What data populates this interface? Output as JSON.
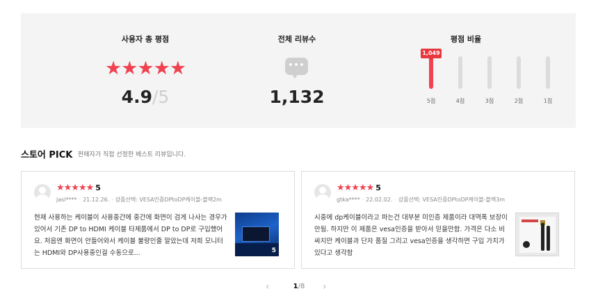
{
  "summary": {
    "total_rating_title": "사용자 총 평점",
    "stars": "★★★★★",
    "score": "4.9",
    "score_slash": "/",
    "score_max": "5",
    "review_count_title": "전체 리뷰수",
    "review_count": "1,132",
    "ratio_title": "평점 비율",
    "ratio_bars": [
      {
        "label": "5점",
        "count": "1,049",
        "fraction": 1.0
      },
      {
        "label": "4점",
        "count": "",
        "fraction": 0
      },
      {
        "label": "3점",
        "count": "",
        "fraction": 0
      },
      {
        "label": "2점",
        "count": "",
        "fraction": 0
      },
      {
        "label": "1점",
        "count": "",
        "fraction": 0
      }
    ]
  },
  "pick": {
    "title": "스토어 PICK",
    "subtitle": "판매자가 직접 선정한 베스트 리뷰입니다."
  },
  "reviews": [
    {
      "stars": "★★★★★",
      "rating": "5",
      "user": "jasl****",
      "date": "21.12.26.",
      "option": "상품선택: VESA인증DPtoDP케이블-블랙2m",
      "text": "현재 사용하는 케이블이 사용중간에 중간에 화면이 검게 나사는 경우가 있어서 기존 DP to HDMI 케이블 타제품에서 DP to DP로 구입했어요. 처음엔 화면이 안들어와서 케이블 불량인줄 알았는데 저희 모니터는 HDMI와 DP사용중인걸 수동으로...",
      "image_count": "5"
    },
    {
      "stars": "★★★★★",
      "rating": "5",
      "user": "gtka****",
      "date": "22.02.02.",
      "option": "상품선택: VESA인증DPtoDP케이블-블랙3m",
      "text": "시중에 dp케이블이라고 파는건 대부분 미인증 제품이라 대역폭 보장이 안됨. 하지만 이 제품은 vesa인증을 받아서 믿을만함. 가격은 다소 비싸지만 케이블과 단자 품질 그리고 vesa인증을 생각하면 구입 가치가 있다고 생각함",
      "image_count": ""
    }
  ],
  "pagination": {
    "current": "1",
    "separator": "/",
    "total": "8",
    "prev_icon": "chevron-left-icon",
    "next_icon": "chevron-right-icon"
  },
  "colors": {
    "accent": "#f0434f",
    "panel_bg": "#f4f4f4"
  }
}
